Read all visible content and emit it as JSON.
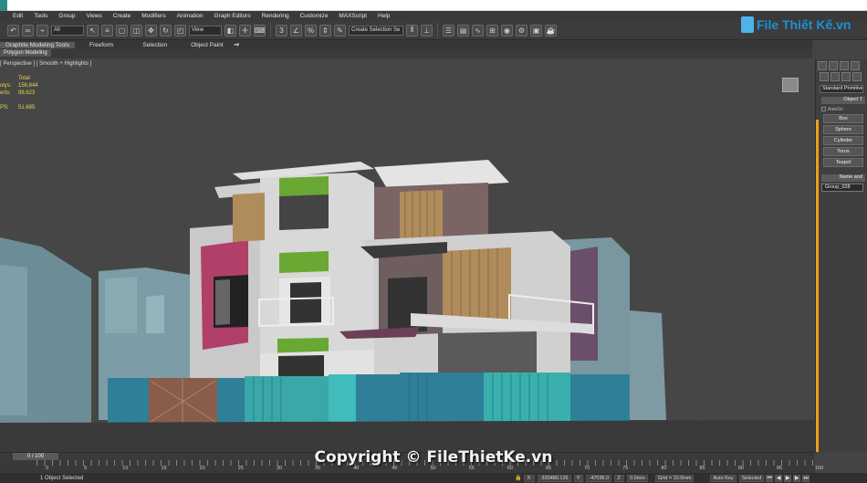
{
  "menu": [
    "Edit",
    "Tools",
    "Group",
    "Views",
    "Create",
    "Modifiers",
    "Animation",
    "Graph Editors",
    "Rendering",
    "Customize",
    "MAXScript",
    "Help"
  ],
  "toolbar": {
    "selection_filter": "All",
    "reference_coord": "View",
    "named_selection": "Create Selection Se"
  },
  "ribbon": {
    "tabs": [
      "Graphite Modeling Tools",
      "Freeform",
      "Selection",
      "Object Paint"
    ],
    "subtab": "Polygon Modeling"
  },
  "viewport": {
    "label": "[ Perspective ] [ Smooth + Highlights ]",
    "stats": {
      "header": "Total",
      "polys_label": "olys:",
      "polys": "156,844",
      "verts_label": "erts:",
      "verts": "98,623",
      "fps_label": "PS:",
      "fps": "51.685"
    }
  },
  "command_panel": {
    "category": "Standard Primitives",
    "object_type_title": "Object T",
    "autogrid": "AutoGri",
    "buttons": [
      "Box",
      "Sphere",
      "Cylinder",
      "Torus",
      "Teapot"
    ],
    "name_title": "Name and",
    "object_name": "Group_028"
  },
  "timeline": {
    "frame": "0 / 100",
    "ticks": [
      "0",
      "5",
      "10",
      "15",
      "20",
      "25",
      "30",
      "35",
      "40",
      "45",
      "50",
      "55",
      "60",
      "65",
      "70",
      "75",
      "80",
      "85",
      "90",
      "95",
      "100"
    ]
  },
  "status": {
    "message": "1 Object Selected",
    "x_label": "X:",
    "x": "-320480.126",
    "y_label": "Y:",
    "y": "-47036.0",
    "z_label": "Z:",
    "z": "0.0mm",
    "grid": "Grid = 10.0mm",
    "autokey": "Auto Key",
    "key_filter": "Selected"
  },
  "watermarks": {
    "logo": "File Thiết Kế.vn",
    "copyright": "Copyright © FileThietKe.vn"
  },
  "colors": {
    "accent_orange": "#e8a020",
    "stats_yellow": "#e8d54a",
    "logo_blue": "#1e8fd6"
  }
}
